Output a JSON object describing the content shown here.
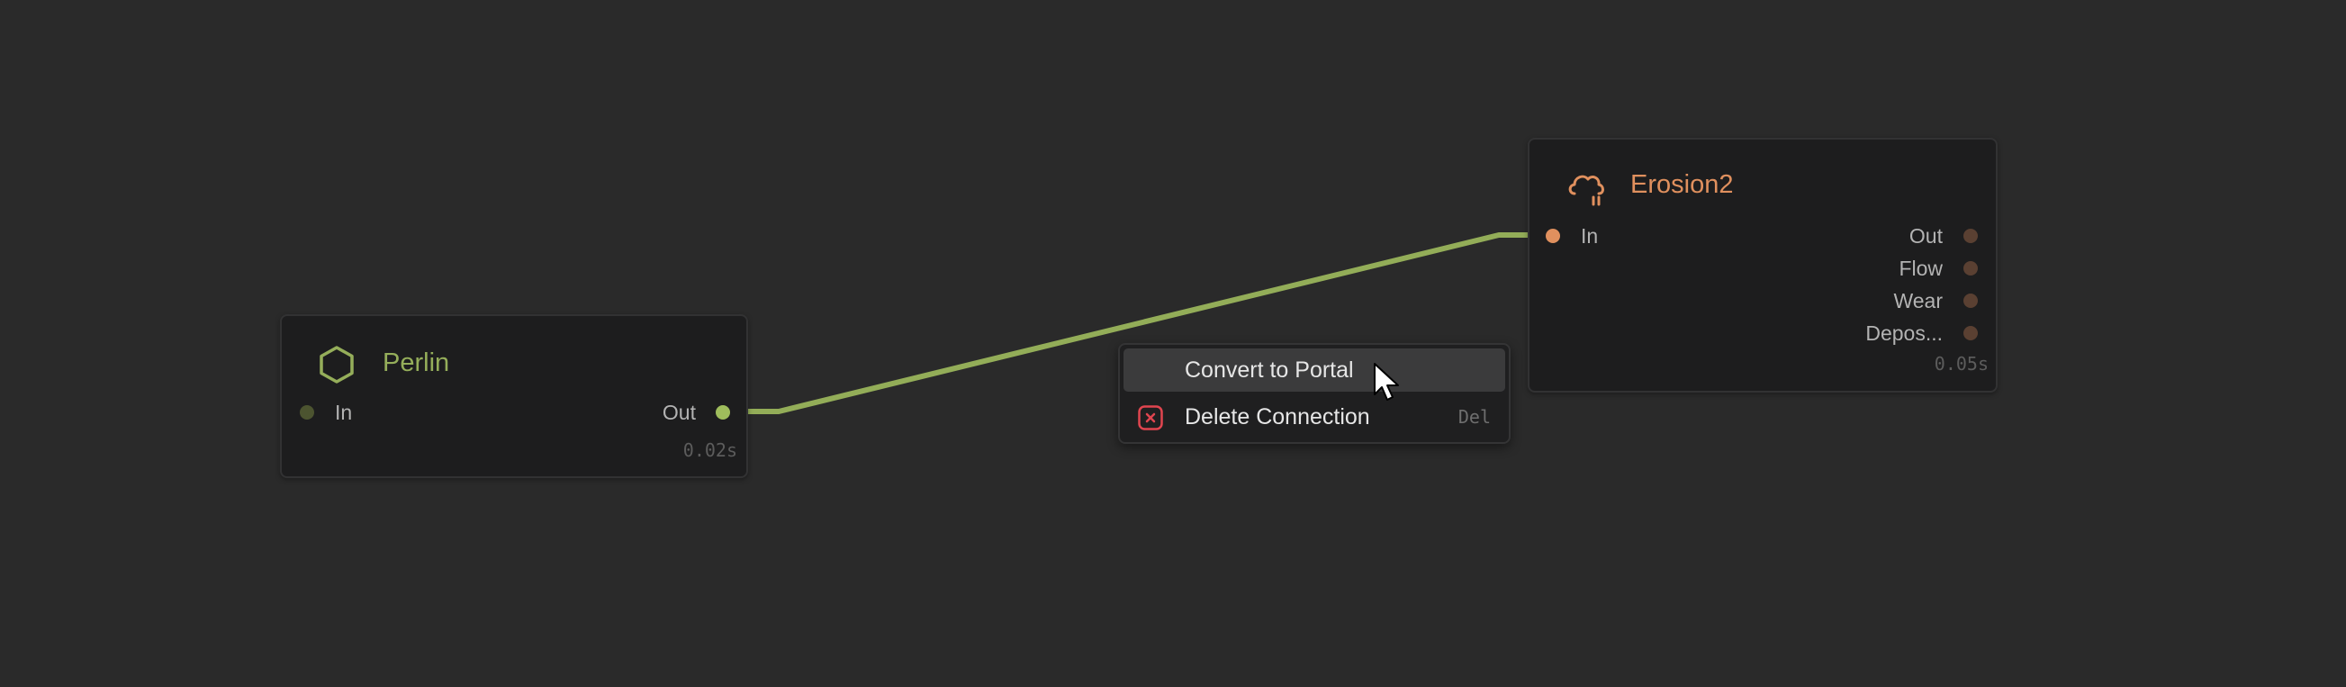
{
  "colors": {
    "background": "#2a2a2a",
    "node_bg": "#1d1d1e",
    "perlin_accent": "#95ae5a",
    "erosion_accent": "#e0905e",
    "wire": "#93ad58",
    "delete_icon": "#e0454f"
  },
  "nodes": {
    "perlin": {
      "title": "Perlin",
      "icon": "hexagon-icon",
      "inputs": [
        {
          "label": "In"
        }
      ],
      "outputs": [
        {
          "label": "Out"
        }
      ],
      "timing": "0.02s"
    },
    "erosion": {
      "title": "Erosion2",
      "icon": "cloud-rain-icon",
      "inputs": [
        {
          "label": "In"
        }
      ],
      "outputs": [
        {
          "label": "Out"
        },
        {
          "label": "Flow"
        },
        {
          "label": "Wear"
        },
        {
          "label": "Depos..."
        }
      ],
      "timing": "0.05s"
    }
  },
  "connection": {
    "from": "Perlin.Out",
    "to": "Erosion2.In"
  },
  "context_menu": {
    "items": [
      {
        "label": "Convert to Portal",
        "shortcut": "",
        "icon": ""
      },
      {
        "label": "Delete Connection",
        "shortcut": "Del",
        "icon": "delete-x-icon"
      }
    ]
  }
}
